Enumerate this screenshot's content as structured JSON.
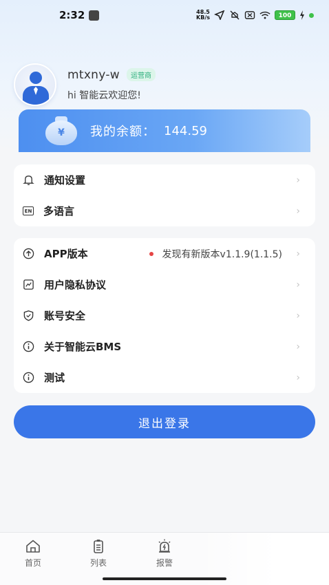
{
  "status_bar": {
    "time": "2:32",
    "net_speed_top": "48.5",
    "net_speed_bottom": "KB/s",
    "battery": "100"
  },
  "profile": {
    "username": "mtxny-w",
    "role": "运营商",
    "greeting": "hi 智能云欢迎您!"
  },
  "balance": {
    "label": "我的余额：",
    "value": "144.59",
    "icon_symbol": "¥"
  },
  "settings_group_1": [
    {
      "icon": "bell-icon",
      "label": "通知设置"
    },
    {
      "icon": "language-icon",
      "icon_text": "EN",
      "label": "多语言"
    }
  ],
  "settings_group_2": [
    {
      "icon": "upload-icon",
      "label": "APP版本",
      "value": "发现有新版本v1.1.9(1.1.5)",
      "badge_color": "#e54545"
    },
    {
      "icon": "privacy-icon",
      "label": "用户隐私协议"
    },
    {
      "icon": "shield-icon",
      "label": "账号安全"
    },
    {
      "icon": "info-icon",
      "label": "关于智能云BMS"
    },
    {
      "icon": "info-icon",
      "label": "测试"
    }
  ],
  "logout_label": "退出登录",
  "tabs": [
    {
      "icon": "home-icon",
      "label": "首页"
    },
    {
      "icon": "list-icon",
      "label": "列表"
    },
    {
      "icon": "alarm-icon",
      "label": "报警"
    }
  ],
  "colors": {
    "primary": "#3a76e8",
    "role_badge": "#2eaf7d",
    "battery": "#3fc14a"
  }
}
